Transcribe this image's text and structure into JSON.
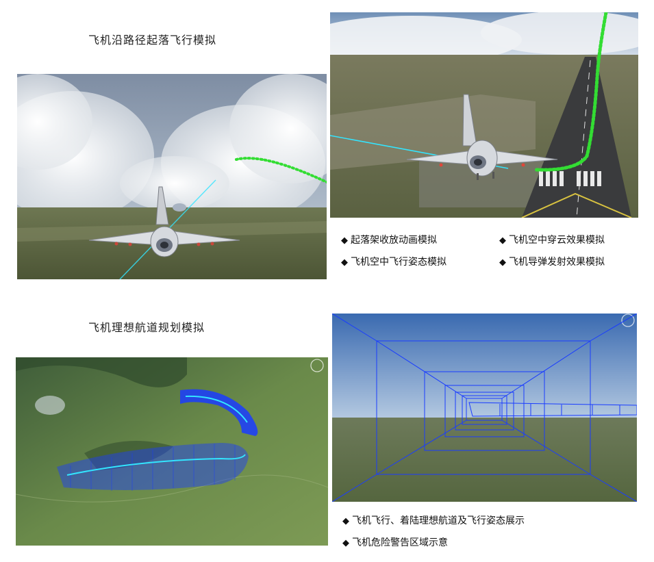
{
  "section1": {
    "title": "飞机沿路径起落飞行模拟",
    "bullets": [
      "起落架收放动画模拟",
      "飞机空中穿云效果模拟",
      "飞机空中飞行姿态模拟",
      "飞机导弹发射效果模拟"
    ]
  },
  "section2": {
    "title": "飞机理想航道规划模拟",
    "bullets": [
      "飞机飞行、着陆理想航道及飞行姿态展示",
      "飞机危险警告区域示意"
    ]
  },
  "bullet_symbol": "◆",
  "colors": {
    "path_green": "#33dd33",
    "corridor_blue": "#1a3cff",
    "route_cyan": "#33e5ff",
    "sky_blue": "#3c6fb5",
    "terrain_green": "#5d7a45"
  }
}
